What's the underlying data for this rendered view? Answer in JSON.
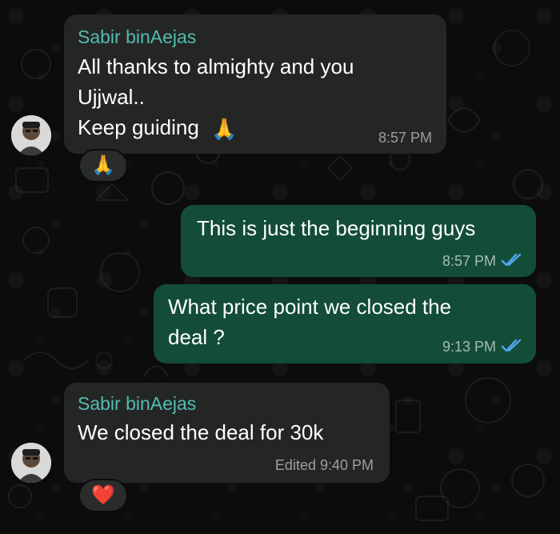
{
  "chat": {
    "messages": [
      {
        "sender": "Sabir binAejas",
        "lines": [
          "All thanks to almighty and you",
          "Ujjwal..",
          "Keep guiding"
        ],
        "time": "8:57 PM",
        "reaction": "🙏"
      },
      {
        "lines": [
          "This is just the beginning guys"
        ],
        "time": "8:57 PM",
        "status": "read"
      },
      {
        "lines": [
          "What price point we closed the",
          "deal ?"
        ],
        "time": "9:13 PM",
        "status": "read"
      },
      {
        "sender": "Sabir binAejas",
        "lines": [
          "We closed the deal for 30k"
        ],
        "time": "Edited 9:40 PM",
        "reaction": "❤️"
      }
    ]
  },
  "colors": {
    "incoming_bubble": "#242626",
    "outgoing_bubble": "#134d37",
    "sender_name": "#53bdae",
    "read_ticks": "#53a6f0"
  },
  "icons": [
    "folded-hands-emoji",
    "double-check-icon",
    "red-heart-emoji",
    "avatar"
  ]
}
